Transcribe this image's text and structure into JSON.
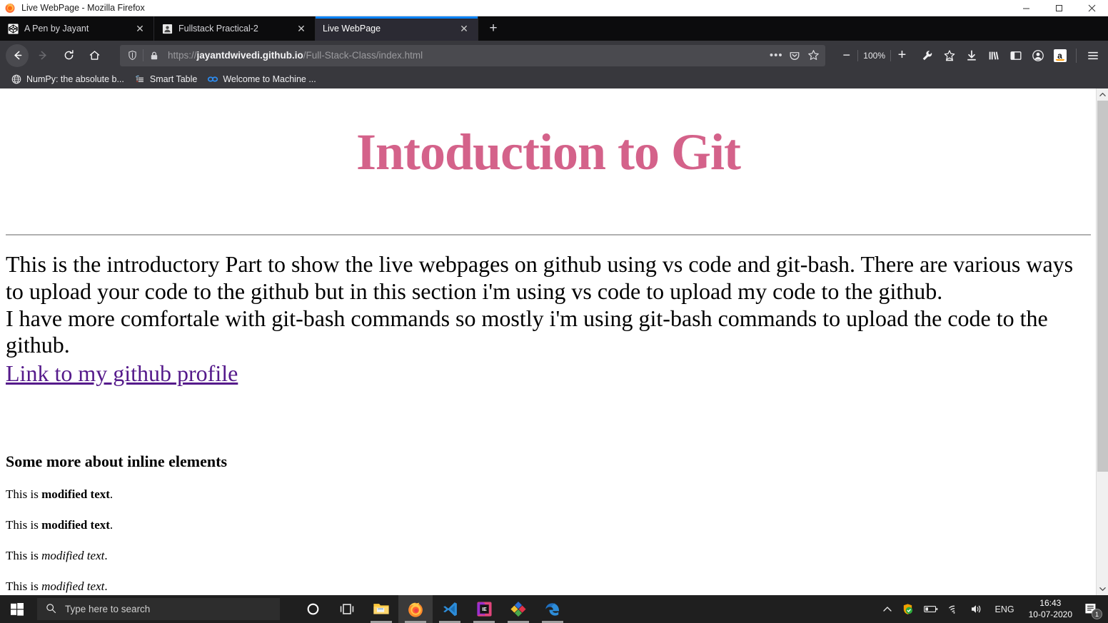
{
  "window": {
    "title": "Live WebPage - Mozilla Firefox",
    "minimize_label": "–",
    "maximize_label": "❐",
    "close_label": "✕"
  },
  "tabs": [
    {
      "label": "A Pen by Jayant",
      "icon": "codepen-icon",
      "close_label": "✕",
      "active": false
    },
    {
      "label": "Fullstack Practical-2",
      "icon": "document-icon",
      "close_label": "✕",
      "active": false
    },
    {
      "label": "Live WebPage",
      "icon": "blank-icon",
      "close_label": "✕",
      "active": true
    }
  ],
  "newtab_label": "+",
  "nav": {
    "back_icon": "back-arrow-icon",
    "forward_icon": "forward-arrow-icon",
    "reload_icon": "reload-icon",
    "home_icon": "home-icon",
    "shield_icon": "shield-icon",
    "lock_icon": "padlock-icon",
    "url_scheme": "https://",
    "url_host": "jayantdwivedi.github.io",
    "url_path": "/Full-Stack-Class/index.html",
    "page_actions_label": "•••",
    "pocket_icon": "pocket-icon",
    "bookmark_star_icon": "star-icon"
  },
  "toolbar": {
    "zoom_out_label": "−",
    "zoom_level": "100%",
    "zoom_in_label": "+",
    "icons": [
      "wrench-icon",
      "save-to-pocket-icon",
      "downloads-icon",
      "library-icon",
      "sidebar-icon",
      "account-icon",
      "amazon-icon"
    ],
    "amazon_label": "a",
    "menu_icon": "hamburger-menu-icon"
  },
  "bookmarks": [
    {
      "label": "NumPy: the absolute b...",
      "icon": "globe-icon"
    },
    {
      "label": "Smart Table",
      "icon": "table-icon"
    },
    {
      "label": "Welcome to Machine ...",
      "icon": "colab-icon"
    }
  ],
  "page": {
    "heading": "Intoduction to Git",
    "heading_color": "#d4628a",
    "paragraph_1": "This is the introductory Part to show the live webpages on github using vs code and git-bash. There are various ways to upload your code to the github but in this section i'm using vs code to upload my code to the github.",
    "paragraph_2": "I have more comfortale with git-bash commands so mostly i'm using git-bash commands to upload the code to the github.",
    "link_text": "Link to my github profile",
    "link_color": "#551a8b",
    "subheading": "Some more about inline elements",
    "inline_lines": [
      {
        "prefix": "This is ",
        "emphasis": "modified text",
        "style": "bold",
        "suffix": "."
      },
      {
        "prefix": "This is ",
        "emphasis": "modified text",
        "style": "bold",
        "suffix": "."
      },
      {
        "prefix": "This is ",
        "emphasis": "modified text",
        "style": "italic",
        "suffix": "."
      },
      {
        "prefix": "This is ",
        "emphasis": "modified text",
        "style": "italic",
        "suffix": "."
      }
    ]
  },
  "scrollbar": {
    "up_arrow": "▲",
    "down_arrow": "▼"
  },
  "taskbar": {
    "start_icon": "windows-start-icon",
    "search_placeholder": "Type here to search",
    "search_icon": "search-icon",
    "apps": [
      {
        "name": "cortana-icon",
        "active": false,
        "running": false
      },
      {
        "name": "task-view-icon",
        "active": false,
        "running": false
      },
      {
        "name": "file-explorer-icon",
        "active": false,
        "running": true
      },
      {
        "name": "firefox-icon",
        "active": true,
        "running": true
      },
      {
        "name": "vscode-icon",
        "active": false,
        "running": true
      },
      {
        "name": "intellij-icon",
        "active": false,
        "running": true
      },
      {
        "name": "photos-icon",
        "active": false,
        "running": true
      },
      {
        "name": "edge-icon",
        "active": false,
        "running": true
      }
    ],
    "tray": {
      "overflow_icon": "chevron-up-icon",
      "antivirus_icon": "antivirus-shield-icon",
      "battery_icon": "battery-icon",
      "wifi_icon": "wifi-icon",
      "volume_icon": "speaker-icon",
      "language": "ENG",
      "time": "16:43",
      "date": "10-07-2020",
      "notification_icon": "notification-icon",
      "notification_count": "1"
    }
  }
}
